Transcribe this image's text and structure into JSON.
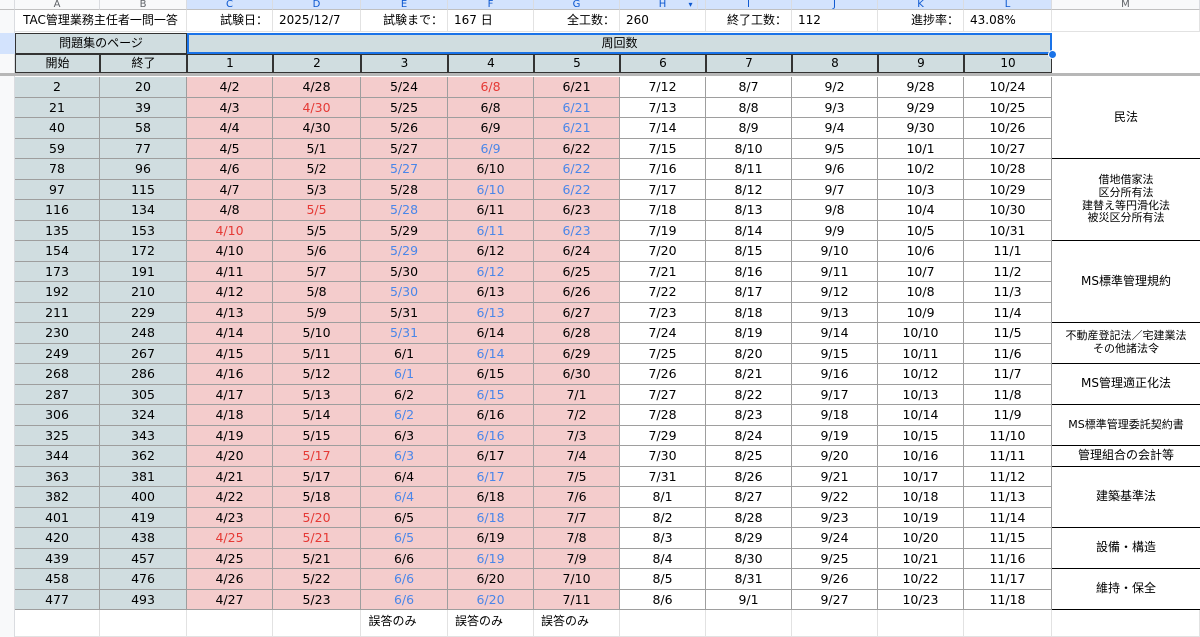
{
  "columns": [
    "A",
    "B",
    "C",
    "D",
    "E",
    "F",
    "G",
    "H",
    "I",
    "J",
    "K",
    "L",
    "M"
  ],
  "dropdown_icon": "dropdown-arrow-icon",
  "info_row": {
    "title": "TAC管理業務主任者一問一答",
    "exam_date_label": "試験日：",
    "exam_date_value": "2025/12/7",
    "until_label": "試験まで：",
    "until_value": "167 日",
    "total_label": "全工数：",
    "total_value": "260",
    "done_label": "終了工数：",
    "done_value": "112",
    "progress_label": "進捗率：",
    "progress_value": "43.08%"
  },
  "header": {
    "pages_title": "問題集のページ",
    "cycles_title": "周回数",
    "start_label": "開始",
    "end_label": "終了",
    "cycles": [
      "1",
      "2",
      "3",
      "4",
      "5",
      "6",
      "7",
      "8",
      "9",
      "10"
    ]
  },
  "rows": [
    {
      "start": "2",
      "end": "20",
      "c": [
        [
          "4/2",
          ""
        ],
        [
          "4/28",
          ""
        ],
        [
          "5/24",
          ""
        ],
        [
          "6/8",
          "red"
        ],
        [
          "6/21",
          ""
        ],
        [
          "7/12",
          ""
        ],
        [
          "8/7",
          ""
        ],
        [
          "9/2",
          ""
        ],
        [
          "9/28",
          ""
        ],
        [
          "10/24",
          ""
        ]
      ]
    },
    {
      "start": "21",
      "end": "39",
      "c": [
        [
          "4/3",
          ""
        ],
        [
          "4/30",
          "red"
        ],
        [
          "5/25",
          ""
        ],
        [
          "6/8",
          ""
        ],
        [
          "6/21",
          "blue"
        ],
        [
          "7/13",
          ""
        ],
        [
          "8/8",
          ""
        ],
        [
          "9/3",
          ""
        ],
        [
          "9/29",
          ""
        ],
        [
          "10/25",
          ""
        ]
      ]
    },
    {
      "start": "40",
      "end": "58",
      "c": [
        [
          "4/4",
          ""
        ],
        [
          "4/30",
          ""
        ],
        [
          "5/26",
          ""
        ],
        [
          "6/9",
          ""
        ],
        [
          "6/21",
          "blue"
        ],
        [
          "7/14",
          ""
        ],
        [
          "8/9",
          ""
        ],
        [
          "9/4",
          ""
        ],
        [
          "9/30",
          ""
        ],
        [
          "10/26",
          ""
        ]
      ]
    },
    {
      "start": "59",
      "end": "77",
      "c": [
        [
          "4/5",
          ""
        ],
        [
          "5/1",
          ""
        ],
        [
          "5/27",
          ""
        ],
        [
          "6/9",
          "blue"
        ],
        [
          "6/22",
          ""
        ],
        [
          "7/15",
          ""
        ],
        [
          "8/10",
          ""
        ],
        [
          "9/5",
          ""
        ],
        [
          "10/1",
          ""
        ],
        [
          "10/27",
          ""
        ]
      ]
    },
    {
      "start": "78",
      "end": "96",
      "c": [
        [
          "4/6",
          ""
        ],
        [
          "5/2",
          ""
        ],
        [
          "5/27",
          "blue"
        ],
        [
          "6/10",
          ""
        ],
        [
          "6/22",
          "blue"
        ],
        [
          "7/16",
          ""
        ],
        [
          "8/11",
          ""
        ],
        [
          "9/6",
          ""
        ],
        [
          "10/2",
          ""
        ],
        [
          "10/28",
          ""
        ]
      ]
    },
    {
      "start": "97",
      "end": "115",
      "c": [
        [
          "4/7",
          ""
        ],
        [
          "5/3",
          ""
        ],
        [
          "5/28",
          ""
        ],
        [
          "6/10",
          "blue"
        ],
        [
          "6/22",
          "blue"
        ],
        [
          "7/17",
          ""
        ],
        [
          "8/12",
          ""
        ],
        [
          "9/7",
          ""
        ],
        [
          "10/3",
          ""
        ],
        [
          "10/29",
          ""
        ]
      ]
    },
    {
      "start": "116",
      "end": "134",
      "c": [
        [
          "4/8",
          ""
        ],
        [
          "5/5",
          "red"
        ],
        [
          "5/28",
          "blue"
        ],
        [
          "6/11",
          ""
        ],
        [
          "6/23",
          ""
        ],
        [
          "7/18",
          ""
        ],
        [
          "8/13",
          ""
        ],
        [
          "9/8",
          ""
        ],
        [
          "10/4",
          ""
        ],
        [
          "10/30",
          ""
        ]
      ]
    },
    {
      "start": "135",
      "end": "153",
      "c": [
        [
          "4/10",
          "red"
        ],
        [
          "5/5",
          ""
        ],
        [
          "5/29",
          ""
        ],
        [
          "6/11",
          "blue"
        ],
        [
          "6/23",
          "blue"
        ],
        [
          "7/19",
          ""
        ],
        [
          "8/14",
          ""
        ],
        [
          "9/9",
          ""
        ],
        [
          "10/5",
          ""
        ],
        [
          "10/31",
          ""
        ]
      ]
    },
    {
      "start": "154",
      "end": "172",
      "c": [
        [
          "4/10",
          ""
        ],
        [
          "5/6",
          ""
        ],
        [
          "5/29",
          "blue"
        ],
        [
          "6/12",
          ""
        ],
        [
          "6/24",
          ""
        ],
        [
          "7/20",
          ""
        ],
        [
          "8/15",
          ""
        ],
        [
          "9/10",
          ""
        ],
        [
          "10/6",
          ""
        ],
        [
          "11/1",
          ""
        ]
      ]
    },
    {
      "start": "173",
      "end": "191",
      "c": [
        [
          "4/11",
          ""
        ],
        [
          "5/7",
          ""
        ],
        [
          "5/30",
          ""
        ],
        [
          "6/12",
          "blue"
        ],
        [
          "6/25",
          ""
        ],
        [
          "7/21",
          ""
        ],
        [
          "8/16",
          ""
        ],
        [
          "9/11",
          ""
        ],
        [
          "10/7",
          ""
        ],
        [
          "11/2",
          ""
        ]
      ]
    },
    {
      "start": "192",
      "end": "210",
      "c": [
        [
          "4/12",
          ""
        ],
        [
          "5/8",
          ""
        ],
        [
          "5/30",
          "blue"
        ],
        [
          "6/13",
          ""
        ],
        [
          "6/26",
          ""
        ],
        [
          "7/22",
          ""
        ],
        [
          "8/17",
          ""
        ],
        [
          "9/12",
          ""
        ],
        [
          "10/8",
          ""
        ],
        [
          "11/3",
          ""
        ]
      ]
    },
    {
      "start": "211",
      "end": "229",
      "c": [
        [
          "4/13",
          ""
        ],
        [
          "5/9",
          ""
        ],
        [
          "5/31",
          ""
        ],
        [
          "6/13",
          "blue"
        ],
        [
          "6/27",
          ""
        ],
        [
          "7/23",
          ""
        ],
        [
          "8/18",
          ""
        ],
        [
          "9/13",
          ""
        ],
        [
          "10/9",
          ""
        ],
        [
          "11/4",
          ""
        ]
      ]
    },
    {
      "start": "230",
      "end": "248",
      "c": [
        [
          "4/14",
          ""
        ],
        [
          "5/10",
          ""
        ],
        [
          "5/31",
          "blue"
        ],
        [
          "6/14",
          ""
        ],
        [
          "6/28",
          ""
        ],
        [
          "7/24",
          ""
        ],
        [
          "8/19",
          ""
        ],
        [
          "9/14",
          ""
        ],
        [
          "10/10",
          ""
        ],
        [
          "11/5",
          ""
        ]
      ]
    },
    {
      "start": "249",
      "end": "267",
      "c": [
        [
          "4/15",
          ""
        ],
        [
          "5/11",
          ""
        ],
        [
          "6/1",
          ""
        ],
        [
          "6/14",
          "blue"
        ],
        [
          "6/29",
          ""
        ],
        [
          "7/25",
          ""
        ],
        [
          "8/20",
          ""
        ],
        [
          "9/15",
          ""
        ],
        [
          "10/11",
          ""
        ],
        [
          "11/6",
          ""
        ]
      ]
    },
    {
      "start": "268",
      "end": "286",
      "c": [
        [
          "4/16",
          ""
        ],
        [
          "5/12",
          ""
        ],
        [
          "6/1",
          "blue"
        ],
        [
          "6/15",
          ""
        ],
        [
          "6/30",
          ""
        ],
        [
          "7/26",
          ""
        ],
        [
          "8/21",
          ""
        ],
        [
          "9/16",
          ""
        ],
        [
          "10/12",
          ""
        ],
        [
          "11/7",
          ""
        ]
      ]
    },
    {
      "start": "287",
      "end": "305",
      "c": [
        [
          "4/17",
          ""
        ],
        [
          "5/13",
          ""
        ],
        [
          "6/2",
          ""
        ],
        [
          "6/15",
          "blue"
        ],
        [
          "7/1",
          ""
        ],
        [
          "7/27",
          ""
        ],
        [
          "8/22",
          ""
        ],
        [
          "9/17",
          ""
        ],
        [
          "10/13",
          ""
        ],
        [
          "11/8",
          ""
        ]
      ]
    },
    {
      "start": "306",
      "end": "324",
      "c": [
        [
          "4/18",
          ""
        ],
        [
          "5/14",
          ""
        ],
        [
          "6/2",
          "blue"
        ],
        [
          "6/16",
          ""
        ],
        [
          "7/2",
          ""
        ],
        [
          "7/28",
          ""
        ],
        [
          "8/23",
          ""
        ],
        [
          "9/18",
          ""
        ],
        [
          "10/14",
          ""
        ],
        [
          "11/9",
          ""
        ]
      ]
    },
    {
      "start": "325",
      "end": "343",
      "c": [
        [
          "4/19",
          ""
        ],
        [
          "5/15",
          ""
        ],
        [
          "6/3",
          ""
        ],
        [
          "6/16",
          "blue"
        ],
        [
          "7/3",
          ""
        ],
        [
          "7/29",
          ""
        ],
        [
          "8/24",
          ""
        ],
        [
          "9/19",
          ""
        ],
        [
          "10/15",
          ""
        ],
        [
          "11/10",
          ""
        ]
      ]
    },
    {
      "start": "344",
      "end": "362",
      "c": [
        [
          "4/20",
          ""
        ],
        [
          "5/17",
          "red"
        ],
        [
          "6/3",
          "blue"
        ],
        [
          "6/17",
          ""
        ],
        [
          "7/4",
          ""
        ],
        [
          "7/30",
          ""
        ],
        [
          "8/25",
          ""
        ],
        [
          "9/20",
          ""
        ],
        [
          "10/16",
          ""
        ],
        [
          "11/11",
          ""
        ]
      ]
    },
    {
      "start": "363",
      "end": "381",
      "c": [
        [
          "4/21",
          ""
        ],
        [
          "5/17",
          ""
        ],
        [
          "6/4",
          ""
        ],
        [
          "6/17",
          "blue"
        ],
        [
          "7/5",
          ""
        ],
        [
          "7/31",
          ""
        ],
        [
          "8/26",
          ""
        ],
        [
          "9/21",
          ""
        ],
        [
          "10/17",
          ""
        ],
        [
          "11/12",
          ""
        ]
      ]
    },
    {
      "start": "382",
      "end": "400",
      "c": [
        [
          "4/22",
          ""
        ],
        [
          "5/18",
          ""
        ],
        [
          "6/4",
          "blue"
        ],
        [
          "6/18",
          ""
        ],
        [
          "7/6",
          ""
        ],
        [
          "8/1",
          ""
        ],
        [
          "8/27",
          ""
        ],
        [
          "9/22",
          ""
        ],
        [
          "10/18",
          ""
        ],
        [
          "11/13",
          ""
        ]
      ]
    },
    {
      "start": "401",
      "end": "419",
      "c": [
        [
          "4/23",
          ""
        ],
        [
          "5/20",
          "red"
        ],
        [
          "6/5",
          ""
        ],
        [
          "6/18",
          "blue"
        ],
        [
          "7/7",
          ""
        ],
        [
          "8/2",
          ""
        ],
        [
          "8/28",
          ""
        ],
        [
          "9/23",
          ""
        ],
        [
          "10/19",
          ""
        ],
        [
          "11/14",
          ""
        ]
      ]
    },
    {
      "start": "420",
      "end": "438",
      "c": [
        [
          "4/25",
          "red"
        ],
        [
          "5/21",
          "red"
        ],
        [
          "6/5",
          "blue"
        ],
        [
          "6/19",
          ""
        ],
        [
          "7/8",
          ""
        ],
        [
          "8/3",
          ""
        ],
        [
          "8/29",
          ""
        ],
        [
          "9/24",
          ""
        ],
        [
          "10/20",
          ""
        ],
        [
          "11/15",
          ""
        ]
      ]
    },
    {
      "start": "439",
      "end": "457",
      "c": [
        [
          "4/25",
          ""
        ],
        [
          "5/21",
          ""
        ],
        [
          "6/6",
          ""
        ],
        [
          "6/19",
          "blue"
        ],
        [
          "7/9",
          ""
        ],
        [
          "8/4",
          ""
        ],
        [
          "8/30",
          ""
        ],
        [
          "9/25",
          ""
        ],
        [
          "10/21",
          ""
        ],
        [
          "11/16",
          ""
        ]
      ]
    },
    {
      "start": "458",
      "end": "476",
      "c": [
        [
          "4/26",
          ""
        ],
        [
          "5/22",
          ""
        ],
        [
          "6/6",
          "blue"
        ],
        [
          "6/20",
          ""
        ],
        [
          "7/10",
          ""
        ],
        [
          "8/5",
          ""
        ],
        [
          "8/31",
          ""
        ],
        [
          "9/26",
          ""
        ],
        [
          "10/22",
          ""
        ],
        [
          "11/17",
          ""
        ]
      ]
    },
    {
      "start": "477",
      "end": "493",
      "c": [
        [
          "4/27",
          ""
        ],
        [
          "5/23",
          ""
        ],
        [
          "6/6",
          "blue"
        ],
        [
          "6/20",
          "blue"
        ],
        [
          "7/11",
          ""
        ],
        [
          "8/6",
          ""
        ],
        [
          "9/1",
          ""
        ],
        [
          "9/27",
          ""
        ],
        [
          "10/23",
          ""
        ],
        [
          "11/18",
          ""
        ]
      ]
    }
  ],
  "categories": [
    {
      "label": "民法",
      "from": 0,
      "to": 3
    },
    {
      "label": "借地借家法\n区分所有法\n建替え等円滑化法\n被災区分所有法",
      "from": 4,
      "to": 7
    },
    {
      "label": "MS標準管理規約",
      "from": 8,
      "to": 11
    },
    {
      "label": "不動産登記法／宅建業法\nその他諸法令",
      "from": 12,
      "to": 13
    },
    {
      "label": "MS管理適正化法",
      "from": 14,
      "to": 15
    },
    {
      "label": "MS標準管理委託契約書",
      "from": 16,
      "to": 17
    },
    {
      "label": "管理組合の会計等",
      "from": 18,
      "to": 18
    },
    {
      "label": "建築基準法",
      "from": 19,
      "to": 21
    },
    {
      "label": "設備・構造",
      "from": 22,
      "to": 23
    },
    {
      "label": "維持・保全",
      "from": 24,
      "to": 25
    }
  ],
  "footer": [
    "誤答のみ",
    "誤答のみ",
    "誤答のみ"
  ],
  "colors": {
    "pink": "#f4cccc",
    "grey": "#d0dde0",
    "red": "#e53935",
    "blue": "#4a86e8",
    "selection": "#1a73e8"
  }
}
